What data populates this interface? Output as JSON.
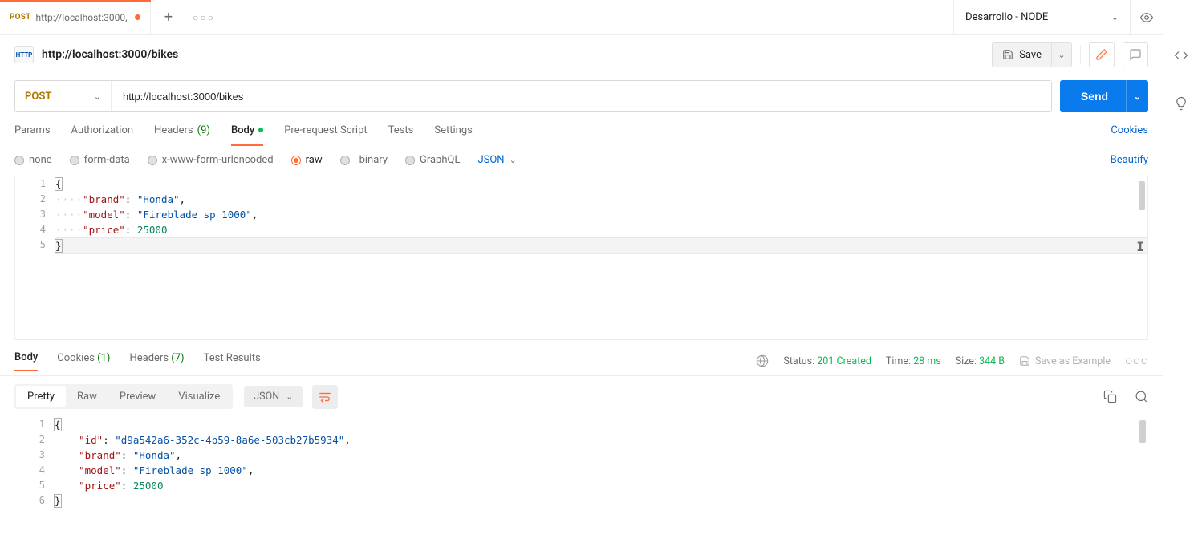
{
  "tabs": {
    "method": "POST",
    "title": "http://localhost:3000,",
    "plus": "+",
    "more": "○○○"
  },
  "environment": {
    "name": "Desarrollo - NODE"
  },
  "request": {
    "http_badge": "HTTP",
    "title": "http://localhost:3000/bikes",
    "method": "POST",
    "url": "http://localhost:3000/bikes",
    "save_label": "Save",
    "send_label": "Send"
  },
  "req_tabs": {
    "params": "Params",
    "authorization": "Authorization",
    "headers_label": "Headers",
    "headers_count": "(9)",
    "body": "Body",
    "prerequest": "Pre-request Script",
    "tests": "Tests",
    "settings": "Settings",
    "cookies": "Cookies"
  },
  "body_types": {
    "none": "none",
    "formdata": "form-data",
    "xwww": "x-www-form-urlencoded",
    "raw": "raw",
    "binary": "binary",
    "graphql": "GraphQL",
    "json": "JSON"
  },
  "beautify": "Beautify",
  "editor_request": {
    "1": {
      "brace": "{"
    },
    "2": {
      "key": "\"brand\"",
      "val": "\"Honda\""
    },
    "3": {
      "key": "\"model\"",
      "val": "\"Fireblade sp 1000\""
    },
    "4": {
      "key": "\"price\"",
      "val": "25000"
    },
    "5": {
      "brace": "}"
    }
  },
  "response_tabs": {
    "body": "Body",
    "cookies_label": "Cookies",
    "cookies_count": "(1)",
    "headers_label": "Headers",
    "headers_count": "(7)",
    "test_results": "Test Results"
  },
  "status": {
    "label": "Status:",
    "value": "201 Created",
    "time_label": "Time:",
    "time_value": "28 ms",
    "size_label": "Size:",
    "size_value": "344 B"
  },
  "save_example": "Save as Example",
  "view_modes": {
    "pretty": "Pretty",
    "raw": "Raw",
    "preview": "Preview",
    "visualize": "Visualize",
    "json": "JSON"
  },
  "editor_response": {
    "1": {
      "brace": "{"
    },
    "2": {
      "key": "\"id\"",
      "val": "\"d9a542a6-352c-4b59-8a6e-503cb27b5934\""
    },
    "3": {
      "key": "\"brand\"",
      "val": "\"Honda\""
    },
    "4": {
      "key": "\"model\"",
      "val": "\"Fireblade sp 1000\""
    },
    "5": {
      "key": "\"price\"",
      "val": "25000"
    },
    "6": {
      "brace": "}"
    }
  },
  "dots4": "····",
  "ln": {
    "1": "1",
    "2": "2",
    "3": "3",
    "4": "4",
    "5": "5",
    "6": "6"
  },
  "punc": {
    "open": "{",
    "close": "}",
    "colon": ":",
    "comma": ",",
    "colon_sp": ": "
  }
}
